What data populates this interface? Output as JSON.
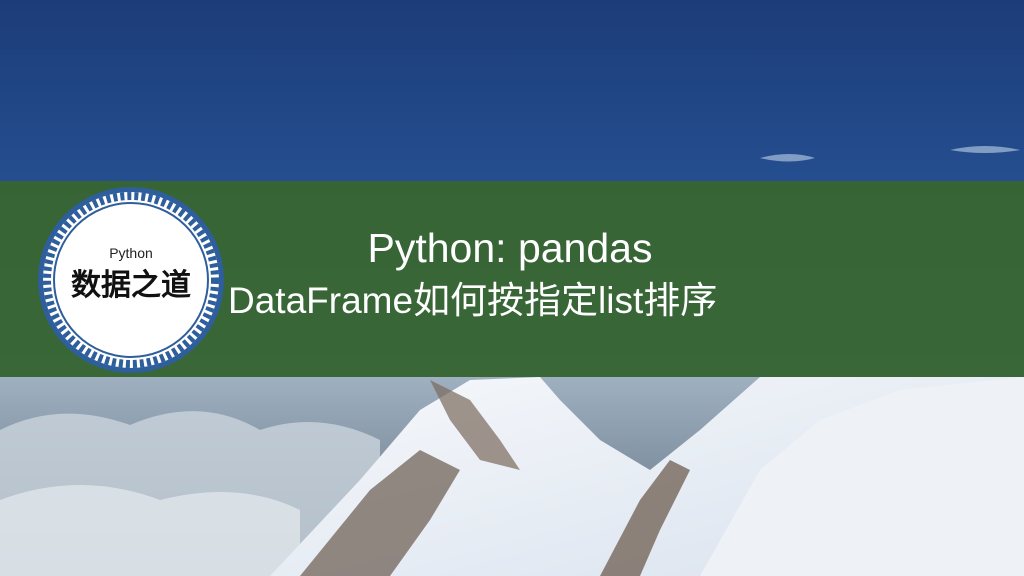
{
  "logo": {
    "top_text": "Python",
    "main_text": "数据之道"
  },
  "title": {
    "line1": "Python: pandas",
    "line2": "DataFrame如何按指定list排序"
  },
  "colors": {
    "sky_top": "#1c3c78",
    "sky_bottom": "#3a72b8",
    "banner": "#3a6828",
    "logo_ring": "#2e5e9c",
    "text": "#ffffff"
  }
}
